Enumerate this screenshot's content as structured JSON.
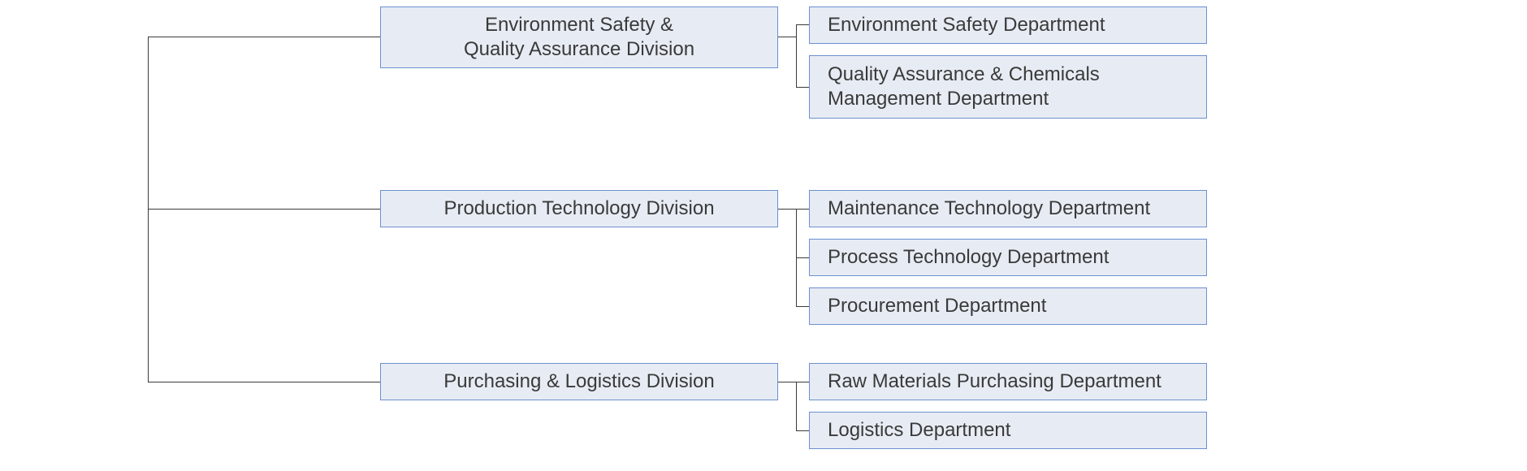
{
  "chart_data": {
    "type": "org-chart",
    "divisions": [
      {
        "name": "Environment Safety &\nQuality Assurance Division",
        "departments": [
          "Environment Safety Department",
          "Quality Assurance & Chemicals Management Department"
        ]
      },
      {
        "name": "Production Technology Division",
        "departments": [
          "Maintenance Technology Department",
          "Process Technology Department",
          "Procurement Department"
        ]
      },
      {
        "name": "Purchasing & Logistics Division",
        "departments": [
          "Raw Materials Purchasing Department",
          "Logistics Department"
        ]
      }
    ]
  },
  "colors": {
    "node_bg": "#e7ecf4",
    "node_border": "#6d8fd0",
    "line": "#3a3a3a",
    "text": "#3a3a3a"
  }
}
